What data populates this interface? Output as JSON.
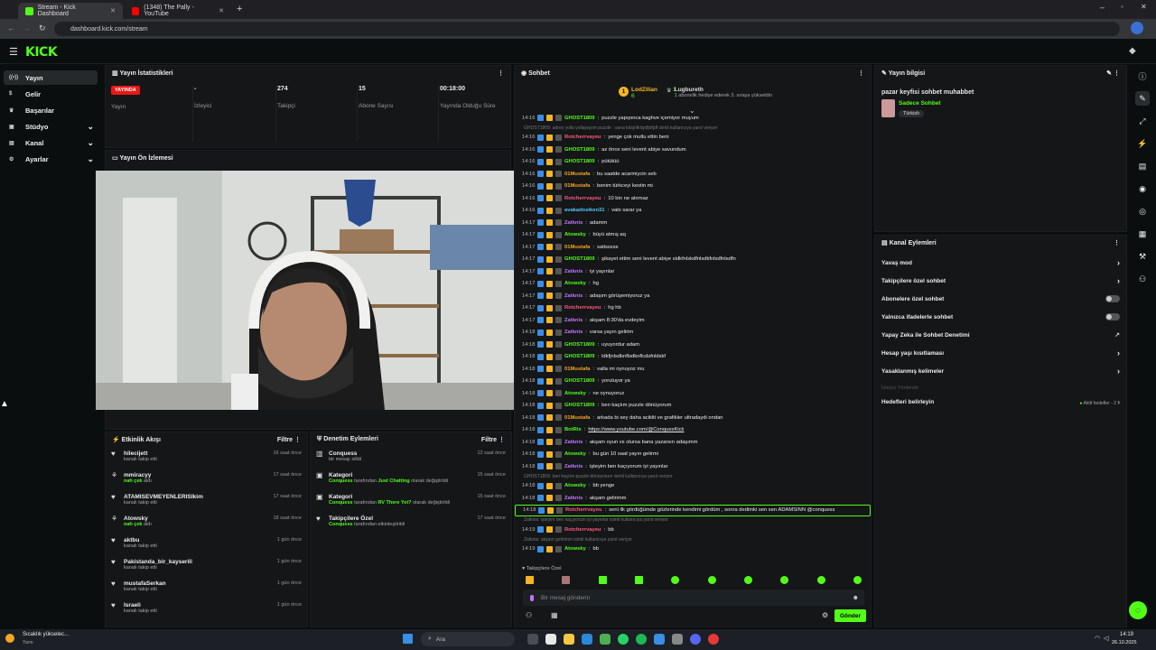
{
  "browser": {
    "tabs": [
      {
        "title": "Stream - Kick Dashboard",
        "active": true,
        "favicon_color": "#53fc18"
      },
      {
        "title": "(1348) The Pally - YouTube",
        "active": false,
        "favicon_color": "#ff0000"
      }
    ],
    "url": "dashboard.kick.com/stream",
    "new_tab_symbol": "+"
  },
  "brand": {
    "logo": "KICK",
    "accent": "#53fc18"
  },
  "sidebar": {
    "items": [
      {
        "label": "Yayın",
        "icon": "broadcast-icon",
        "glyph": "((•))",
        "active": true,
        "chevron": ""
      },
      {
        "label": "Gelir",
        "icon": "dollar-icon",
        "glyph": "$",
        "active": false,
        "chevron": ""
      },
      {
        "label": "Başarılar",
        "icon": "trophy-icon",
        "glyph": "♛",
        "active": false,
        "chevron": ""
      },
      {
        "label": "Stüdyo",
        "icon": "studio-icon",
        "glyph": "▣",
        "active": false,
        "chevron": "⌄"
      },
      {
        "label": "Kanal",
        "icon": "channel-icon",
        "glyph": "▤",
        "active": false,
        "chevron": "⌄"
      },
      {
        "label": "Ayarlar",
        "icon": "gear-icon",
        "glyph": "⚙",
        "active": false,
        "chevron": "⌄"
      }
    ]
  },
  "stats": {
    "title": "Yayın İstatistikleri",
    "live_badge": "YAYINDA",
    "cells": [
      {
        "value": "",
        "label": "Yayın"
      },
      {
        "value": "-",
        "label": "İzleyici"
      },
      {
        "value": "274",
        "label": "Takipçi"
      },
      {
        "value": "15",
        "label": "Abone Sayısı"
      },
      {
        "value": "00:18:00",
        "label": "Yayında Olduğu Süre"
      }
    ]
  },
  "preview": {
    "title": "Yayın Ön İzlemesi"
  },
  "activity": {
    "title": "Etkinlik Akışı",
    "filter": "Filtre",
    "items": [
      {
        "name": "hilecijett",
        "sub": "kanalı takip etti",
        "time": "16 saat önce",
        "icon": "heart-icon",
        "highlight": ""
      },
      {
        "name": "mmiracyy",
        "sub": "aldı",
        "hl": "nah çek",
        "time": "17 saat önce",
        "icon": "bits-icon"
      },
      {
        "name": "ATAMISEVMEYENLERISIkim",
        "sub": "kanalı takip etti",
        "time": "17 saat önce",
        "icon": "heart-icon",
        "hl": ""
      },
      {
        "name": "Atowsky",
        "sub": "aldı",
        "hl": "nah çek",
        "time": "18 saat önce",
        "icon": "bits-icon"
      },
      {
        "name": "aktbu",
        "sub": "kanalı takip etti",
        "time": "1 gün önce",
        "icon": "heart-icon",
        "hl": ""
      },
      {
        "name": "Pakistanda_bir_kayserili",
        "sub": "kanalı takip etti",
        "time": "1 gün önce",
        "icon": "heart-icon",
        "hl": ""
      },
      {
        "name": "mustafaSerkan",
        "sub": "kanalı takip etti",
        "time": "1 gün önce",
        "icon": "heart-icon",
        "hl": ""
      },
      {
        "name": "Israeli",
        "sub": "kanalı takip etti",
        "time": "1 gün önce",
        "icon": "heart-icon",
        "hl": ""
      }
    ]
  },
  "moderation": {
    "title": "Denetim Eylemleri",
    "filter": "Filtre",
    "items": [
      {
        "title": "Conquess",
        "line": "bir mesajı silldi",
        "time": "12 saat önce",
        "icon": "trash-icon"
      },
      {
        "title": "Kategori",
        "user": "Conquess",
        "mid": "tarafından",
        "cat": "Just Chatting",
        "tail": "olarak değiştirildi",
        "time": "15 saat önce",
        "icon": "category-icon"
      },
      {
        "title": "Kategori",
        "user": "Conquess",
        "mid": "tarafından",
        "cat": "RV There Yet?",
        "tail": "olarak değiştirildi",
        "time": "15 saat önce",
        "icon": "category-icon"
      },
      {
        "title": "Takipçilere Özel",
        "user": "Conquess",
        "mid": "tarafından etkinleştirildi",
        "cat": "",
        "tail": "",
        "time": "17 saat önce",
        "icon": "heart-icon"
      }
    ]
  },
  "chat": {
    "title": "Sohbet",
    "top_gifters": [
      {
        "name": "LodZilian",
        "count": "6",
        "rank": "1"
      },
      {
        "name": "Lugbureth",
        "count": "1",
        "note": "1 abonelik hediye ederek 3. sıraya yükseldin"
      }
    ],
    "lines": [
      {
        "kind": "msg",
        "time": "14:16",
        "user": "GHOST1809",
        "color": "#53fc18",
        "text": "puzzle yapıpınca kaghve içemiyor muyum"
      },
      {
        "kind": "reply",
        "text": "GHOST1809: adres yolla yollayayım puzzle : sana kdsjnfklsjdfjdfjdf isimli kullanıcıya yanıt veriyor"
      },
      {
        "kind": "msg",
        "time": "14:16",
        "user": "Rotcherrvayeu",
        "color": "#ff5a7a",
        "text": "yenge çok mutlu ettin beni"
      },
      {
        "kind": "msg",
        "time": "14:16",
        "user": "GHOST1809",
        "color": "#53fc18",
        "text": "az önce seni levent abiye savundum"
      },
      {
        "kind": "msg",
        "time": "14:16",
        "user": "GHOST1809",
        "color": "#53fc18",
        "text": "pütütüü"
      },
      {
        "kind": "msg",
        "time": "14:16",
        "user": "01Mustafa",
        "color": "#f5a623",
        "text": "bu saatde acarmiycin seb"
      },
      {
        "kind": "msg",
        "time": "14:16",
        "user": "01Mustafa",
        "color": "#f5a623",
        "text": "benim türkceyi kestin mi"
      },
      {
        "kind": "msg",
        "time": "14:16",
        "user": "Rotcherrvayeu",
        "color": "#ff5a7a",
        "text": "10 bin ne alırmaz"
      },
      {
        "kind": "msg",
        "time": "14:16",
        "user": "avakadosiken31",
        "color": "#53c6fc",
        "text": "valo sarar ya"
      },
      {
        "kind": "msg",
        "time": "14:17",
        "user": "Zatknis",
        "color": "#c377ff",
        "text": "adamm"
      },
      {
        "kind": "msg",
        "time": "14:17",
        "user": "Atowsky",
        "color": "#53fc18",
        "text": "büyü atmış aq"
      },
      {
        "kind": "msg",
        "time": "14:17",
        "user": "01Mustafa",
        "color": "#f5a623",
        "text": "satisssss"
      },
      {
        "kind": "msg",
        "time": "14:17",
        "user": "GHOST1809",
        "color": "#53fc18",
        "text": "şikayet ettim seni levent abiye sidkfnlskdfnlsdkfnlsdfnlsdfn"
      },
      {
        "kind": "msg",
        "time": "14:17",
        "user": "Zatknis",
        "color": "#c377ff",
        "text": "iyi yayınlar"
      },
      {
        "kind": "msg",
        "time": "14:17",
        "user": "Atowsky",
        "color": "#53fc18",
        "text": "hg"
      },
      {
        "kind": "msg",
        "time": "14:17",
        "user": "Zatknis",
        "color": "#c377ff",
        "text": "adaşım görüşemiyoruz ya"
      },
      {
        "kind": "msg",
        "time": "14:17",
        "user": "Rotcherrvayeu",
        "color": "#ff5a7a",
        "text": "hg hb"
      },
      {
        "kind": "msg",
        "time": "14:17",
        "user": "Zatknis",
        "color": "#c377ff",
        "text": "akşam 8:30'da evdeyim"
      },
      {
        "kind": "msg",
        "time": "14:18",
        "user": "Zatknis",
        "color": "#c377ff",
        "text": "varsa yayın gelirim"
      },
      {
        "kind": "msg",
        "time": "14:18",
        "user": "GHOST1809",
        "color": "#53fc18",
        "text": "uyuyordur adam"
      },
      {
        "kind": "msg",
        "time": "14:18",
        "user": "GHOST1809",
        "color": "#53fc18",
        "text": "ldkfjnlsdknflsdknflcdsfnldskf"
      },
      {
        "kind": "msg",
        "time": "14:18",
        "user": "01Mustafa",
        "color": "#f5a623",
        "text": "valla mi oynuyoz mu"
      },
      {
        "kind": "msg",
        "time": "14:18",
        "user": "GHOST1809",
        "color": "#53fc18",
        "text": "yoruluyor ya"
      },
      {
        "kind": "msg",
        "time": "14:18",
        "user": "Atowsky",
        "color": "#53fc18",
        "text": "ne oynuyoruz"
      },
      {
        "kind": "msg",
        "time": "14:18",
        "user": "GHOST1809",
        "color": "#53fc18",
        "text": "ben kaçtım puzzle dönüyorum"
      },
      {
        "kind": "msg",
        "time": "14:18",
        "user": "01Mustafa",
        "color": "#f5a623",
        "text": "arkada bi sey daha aciklti ve grafikler ultradaydi ondan"
      },
      {
        "kind": "msg",
        "time": "14:18",
        "user": "BotRix",
        "color": "#53fc18",
        "text": "https://www.youtube.com/@ConquesKick",
        "link": true
      },
      {
        "kind": "msg",
        "time": "14:18",
        "user": "Zatknis",
        "color": "#c377ff",
        "text": "akşam oyun vs olursa bana yazarsın adaşımm"
      },
      {
        "kind": "msg",
        "time": "14:18",
        "user": "Atowsky",
        "color": "#53fc18",
        "text": "bu gün 10 saat yayın gelirmi"
      },
      {
        "kind": "msg",
        "time": "14:18",
        "user": "Zatknis",
        "color": "#c377ff",
        "text": "işteyim ben kaçıyorum iyi yayınlar"
      },
      {
        "kind": "reply",
        "text": "GHOST1809: ben kaçtım puzzle dönüyorum isimli kullanıcıya yanıt veriyor"
      },
      {
        "kind": "msg",
        "time": "14:18",
        "user": "Atowsky",
        "color": "#53fc18",
        "text": "bb yenge"
      },
      {
        "kind": "msg",
        "time": "14:18",
        "user": "Zatknis",
        "color": "#c377ff",
        "text": "akşam gelirimm"
      },
      {
        "kind": "msg",
        "time": "14:18",
        "user": "Rotcherrvayeu",
        "color": "#ff5a7a",
        "text": "seni ilk gördüğümde gözlerinde kendimi gördüm , sonra dedimki sen sen ADAMSINN @conquess",
        "highlight": true
      },
      {
        "kind": "reply",
        "text": "Zatknis: işteyim ben kaçıyorum iyi yayınlar isimli kullanıcıya yanıt veriyor"
      },
      {
        "kind": "msg",
        "time": "14:19",
        "user": "Rotcherrvayeu",
        "color": "#ff5a7a",
        "text": "bb"
      },
      {
        "kind": "reply",
        "text": "Zatknis: akşam gelirimm isimli kullanıcıya yanıt veriyor"
      },
      {
        "kind": "msg",
        "time": "14:19",
        "user": "Atowsky",
        "color": "#53fc18",
        "text": "bb"
      }
    ],
    "followers_only": "Takipçilere Özel",
    "placeholder": "Bir mesaj gönderin",
    "send": "Gönder"
  },
  "stream_info": {
    "title": "Yayın bilgisi",
    "stream_title": "pazar keyfisi sohbet muhabbet",
    "category": "Sadece Sohbet",
    "tag": "Türkish"
  },
  "channel_actions": {
    "title": "Kanal Eylemleri",
    "rows": [
      {
        "label": "Yavaş mod",
        "control": "chevron"
      },
      {
        "label": "Takipçilere özel sohbet",
        "control": "chevron"
      },
      {
        "label": "Abonelere özel sohbet",
        "control": "toggle"
      },
      {
        "label": "Yalnızca ifadelerle sohbet",
        "control": "toggle"
      },
      {
        "label": "Yapay Zeka ile Sohbet Denetimi",
        "control": "external"
      },
      {
        "label": "Hesap yaşı kısıtlaması",
        "control": "chevron"
      },
      {
        "label": "Yasaklanmış kelimeler",
        "control": "chevron"
      }
    ],
    "section": "İzleyici Yönlendir",
    "goals_label": "Hedefleri belirleyin",
    "goals_status": "Aktif hedefler - 2"
  },
  "taskbar": {
    "weather": "Sıcaklık yükselec...",
    "weather_sub": "Yarın",
    "search": "Ara",
    "time": "14:19",
    "date": "26.10.2025"
  }
}
